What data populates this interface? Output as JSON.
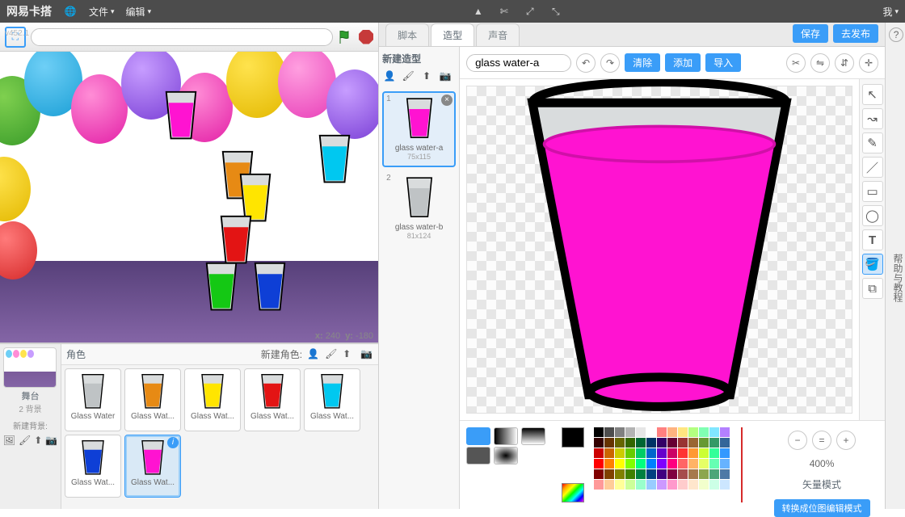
{
  "topbar": {
    "logo": "网易卡搭",
    "menus": [
      "文件",
      "编辑"
    ],
    "right_menu": "我"
  },
  "version": "v452.1",
  "stage": {
    "coords_x_label": "x:",
    "coords_x": "240",
    "coords_y_label": "y:",
    "coords_y": "-180"
  },
  "stagecol": {
    "stage_label": "舞台",
    "backdrops": "2 背景",
    "new_backdrop": "新建背景:"
  },
  "spritepane": {
    "header": "角色",
    "new_sprite": "新建角色:"
  },
  "sprites": [
    {
      "name": "Glass Water",
      "color": "#bfc3c5"
    },
    {
      "name": "Glass Wat...",
      "color": "#e78a14"
    },
    {
      "name": "Glass Wat...",
      "color": "#ffe500"
    },
    {
      "name": "Glass Wat...",
      "color": "#e31414"
    },
    {
      "name": "Glass Wat...",
      "color": "#00c8f0"
    },
    {
      "name": "Glass Wat...",
      "color": "#0e3fd6"
    },
    {
      "name": "Glass Wat...",
      "color": "#ff13d1",
      "selected": true
    }
  ],
  "tabs": {
    "scripts": "脚本",
    "costumes": "造型",
    "sounds": "声音"
  },
  "topbuttons": {
    "save": "保存",
    "publish": "去发布"
  },
  "costumes": {
    "new_label": "新建造型",
    "items": [
      {
        "num": "1",
        "name": "glass water-a",
        "size": "75x115",
        "color": "#ff13d1",
        "selected": true
      },
      {
        "num": "2",
        "name": "glass water-b",
        "size": "81x124",
        "color": "#bfc3c5"
      }
    ]
  },
  "paintbar": {
    "name_value": "glass water-a",
    "buttons": [
      "清除",
      "添加",
      "导入"
    ]
  },
  "vector": {
    "zoom": "400%",
    "mode": "矢量模式",
    "convert": "转换成位图编辑模式"
  },
  "help": {
    "text": "帮助与教程"
  },
  "palette_colors": [
    "#000000",
    "#4d4d4d",
    "#808080",
    "#b3b3b3",
    "#e6e6e6",
    "#ffffff",
    "#ff8080",
    "#ffb380",
    "#ffe680",
    "#b3ff80",
    "#80ffb3",
    "#80e6ff",
    "#b380ff",
    "#330000",
    "#663300",
    "#666600",
    "#336600",
    "#006633",
    "#003366",
    "#330066",
    "#660033",
    "#993333",
    "#996633",
    "#669933",
    "#339966",
    "#336699",
    "#cc0000",
    "#cc6600",
    "#cccc00",
    "#66cc00",
    "#00cc66",
    "#0066cc",
    "#6600cc",
    "#cc0066",
    "#ff3333",
    "#ff9933",
    "#ccff33",
    "#33ff99",
    "#3399ff",
    "#ff0000",
    "#ff8000",
    "#ffff00",
    "#80ff00",
    "#00ff80",
    "#0080ff",
    "#8000ff",
    "#ff0080",
    "#ff6666",
    "#ffb366",
    "#e6ff66",
    "#66ffb3",
    "#66b3ff",
    "#800000",
    "#804000",
    "#808000",
    "#408000",
    "#008040",
    "#004080",
    "#400080",
    "#800040",
    "#a64d4d",
    "#a6794d",
    "#8ca64d",
    "#4da679",
    "#4d79a6",
    "#ff9999",
    "#ffcc99",
    "#ffff99",
    "#ccff99",
    "#99ffcc",
    "#99ccff",
    "#cc99ff",
    "#ff99cc",
    "#ffcccc",
    "#ffe6cc",
    "#f2ffcc",
    "#ccffe6",
    "#cce6ff"
  ]
}
